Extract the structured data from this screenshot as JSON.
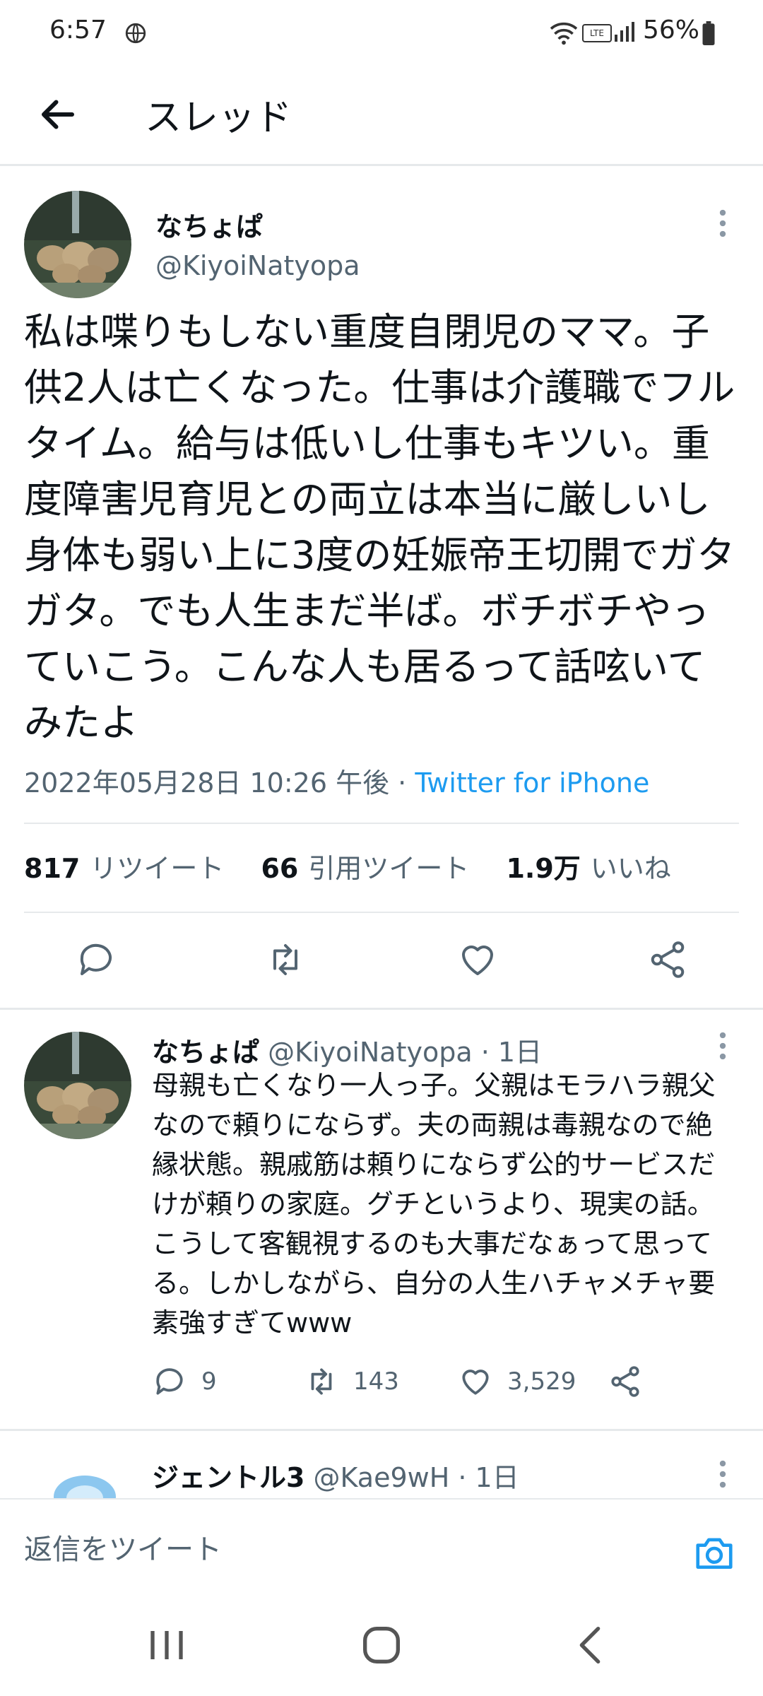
{
  "status_bar": {
    "time": "6:57",
    "battery": "56%"
  },
  "header": {
    "title": "スレッド"
  },
  "main_tweet": {
    "display_name": "なちょぱ",
    "handle": "@KiyoiNatyopa",
    "text": "私は喋りもしない重度自閉児のママ。子供2人は亡くなった。仕事は介護職でフルタイム。給与は低いし仕事もキツい。重度障害児育児との両立は本当に厳しいし身体も弱い上に3度の妊娠帝王切開でガタガタ。でも人生まだ半ば。ボチボチやっていこう。こんな人も居るって話呟いてみたよ",
    "datetime": "2022年05月28日 10:26 午後 · ",
    "source": "Twitter for iPhone",
    "stats": {
      "retweets_count": "817",
      "retweets_label": "リツイート",
      "quotes_count": "66",
      "quotes_label": "引用ツイート",
      "likes_count": "1.9万",
      "likes_label": "いいね"
    }
  },
  "reply": {
    "display_name": "なちょぱ",
    "handle": "@KiyoiNatyopa",
    "time": "· 1日",
    "text": "母親も亡くなり一人っ子。父親はモラハラ親父なので頼りにならず。夫の両親は毒親なので絶縁状態。親戚筋は頼りにならず公的サービスだけが頼りの家庭。グチというより、現実の話。こうして客観視するのも大事だなぁって思ってる。しかしながら、自分の人生ハチャメチャ要素強すぎてwww",
    "replies": "9",
    "retweets": "143",
    "likes": "3,529"
  },
  "reply2": {
    "display_name": "ジェントル3",
    "handle": "@Kae9wH",
    "time": "· 1日"
  },
  "compose": {
    "placeholder": "返信をツイート"
  },
  "colors": {
    "accent": "#1d9bf0",
    "secondary_text": "#536471",
    "primary_text": "#0f1419"
  }
}
